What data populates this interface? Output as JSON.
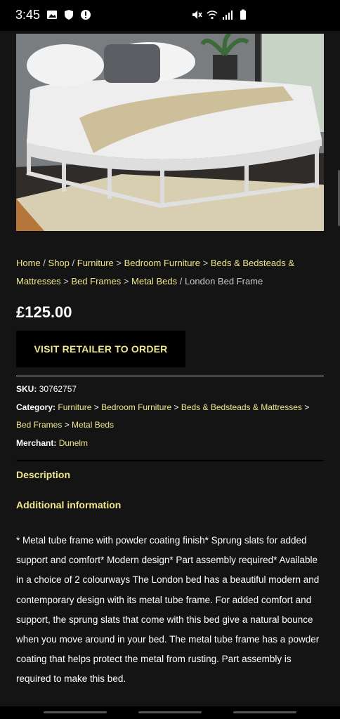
{
  "status_bar": {
    "time": "3:45",
    "left_icons": [
      "image-icon",
      "shield-icon",
      "alert-icon"
    ],
    "right_icons": [
      "mute-icon",
      "wifi-icon",
      "signal-icon",
      "battery-icon"
    ]
  },
  "product": {
    "image_alt": "London Bed Frame",
    "breadcrumb": [
      {
        "label": "Home",
        "link": true
      },
      {
        "label": "Shop",
        "link": true
      },
      {
        "label": "Furniture",
        "link": true
      },
      {
        "label": "Bedroom Furniture",
        "link": true
      },
      {
        "label": "Beds & Bedsteads & Mattresses",
        "link": true
      },
      {
        "label": "Bed Frames",
        "link": true
      },
      {
        "label": "Metal Beds",
        "link": true
      },
      {
        "label": "London Bed Frame",
        "link": false
      }
    ],
    "price": "£125.00",
    "cta_label": "VISIT RETAILER TO ORDER",
    "sku_label": "SKU:",
    "sku_value": "30762757",
    "category_label": "Category:",
    "categories": [
      "Furniture",
      "Bedroom Furniture",
      "Beds & Bedsteads & Mattresses",
      "Bed Frames",
      "Metal Beds"
    ],
    "merchant_label": "Merchant:",
    "merchant_value": "Dunelm",
    "tab_description": "Description",
    "tab_additional": "Additional information",
    "description": "* Metal tube frame with powder coating finish* Sprung slats for added support and comfort* Modern design* Part assembly required* Available in a choice of 2 colourways The London bed has a beautiful modern and contemporary design with its metal tube frame. For added comfort and support, the sprung slats that come with this bed give a natural bounce when you move around in your bed. The metal tube frame has a powder coating that helps protect the metal from rusting. Part assembly is required to make this bed."
  },
  "colors": {
    "accent": "#f0e68c",
    "background": "#141414"
  }
}
